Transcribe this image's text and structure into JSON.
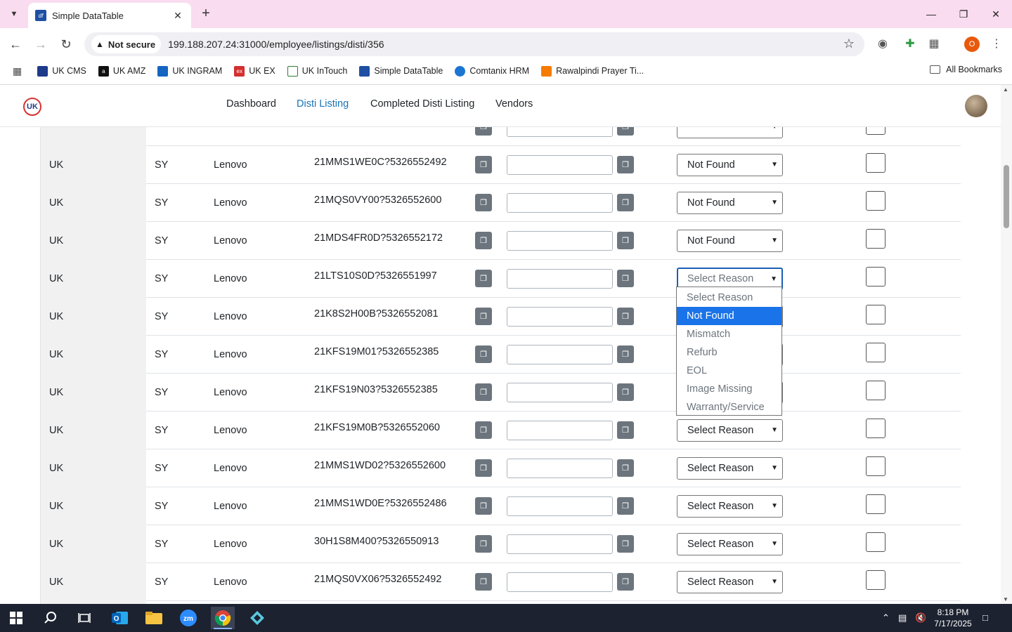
{
  "browser": {
    "tab_title": "Simple DataTable",
    "tab_favicon_text": "df",
    "security_label": "Not secure",
    "url": "199.188.207.24:31000/employee/listings/disti/356",
    "profile_initial": "O",
    "bookmarks": [
      {
        "label": "UK CMS",
        "color": "#1e3a8a"
      },
      {
        "label": "UK AMZ",
        "color": "#111111"
      },
      {
        "label": "UK INGRAM",
        "color": "#1565c0"
      },
      {
        "label": "UK EX",
        "color": "#d32f2f"
      },
      {
        "label": "UK InTouch",
        "color": "#2e7d32"
      },
      {
        "label": "Simple DataTable",
        "color": "#1e4fa3"
      },
      {
        "label": "Comtanix HRM",
        "color": "#1976d2"
      },
      {
        "label": "Rawalpindi Prayer Ti...",
        "color": "#f57c00"
      }
    ],
    "all_bookmarks": "All Bookmarks"
  },
  "app": {
    "logo_text": "UK",
    "nav": [
      "Dashboard",
      "Disti Listing",
      "Completed Disti Listing",
      "Vendors"
    ],
    "active_nav": "Disti Listing"
  },
  "table": {
    "rows": [
      {
        "country": "",
        "code": "",
        "brand": "",
        "sku": "",
        "reason": "",
        "partial": true
      },
      {
        "country": "UK",
        "code": "SY",
        "brand": "Lenovo",
        "sku": "21MMS1WE0C?5326552492",
        "reason": "Not Found"
      },
      {
        "country": "UK",
        "code": "SY",
        "brand": "Lenovo",
        "sku": "21MQS0VY00?5326552600",
        "reason": "Not Found"
      },
      {
        "country": "UK",
        "code": "SY",
        "brand": "Lenovo",
        "sku": "21MDS4FR0D?5326552172",
        "reason": "Not Found"
      },
      {
        "country": "UK",
        "code": "SY",
        "brand": "Lenovo",
        "sku": "21LTS10S0D?5326551997",
        "reason": "Select Reason",
        "focused": true
      },
      {
        "country": "UK",
        "code": "SY",
        "brand": "Lenovo",
        "sku": "21K8S2H00B?5326552081",
        "reason": "Select Reason"
      },
      {
        "country": "UK",
        "code": "SY",
        "brand": "Lenovo",
        "sku": "21KFS19M01?5326552385",
        "reason": "Select Reason"
      },
      {
        "country": "UK",
        "code": "SY",
        "brand": "Lenovo",
        "sku": "21KFS19N03?5326552385",
        "reason": "Select Reason"
      },
      {
        "country": "UK",
        "code": "SY",
        "brand": "Lenovo",
        "sku": "21KFS19M0B?5326552060",
        "reason": "Select Reason"
      },
      {
        "country": "UK",
        "code": "SY",
        "brand": "Lenovo",
        "sku": "21MMS1WD02?5326552600",
        "reason": "Select Reason"
      },
      {
        "country": "UK",
        "code": "SY",
        "brand": "Lenovo",
        "sku": "21MMS1WD0E?5326552486",
        "reason": "Select Reason"
      },
      {
        "country": "UK",
        "code": "SY",
        "brand": "Lenovo",
        "sku": "30H1S8M400?5326550913",
        "reason": "Select Reason"
      },
      {
        "country": "UK",
        "code": "SY",
        "brand": "Lenovo",
        "sku": "21MQS0VX06?5326552492",
        "reason": "Select Reason"
      },
      {
        "country": "",
        "code": "",
        "brand": "",
        "sku": "",
        "reason": "",
        "partial": true
      }
    ],
    "dropdown_options": [
      "Select Reason",
      "Not Found",
      "Mismatch",
      "Refurb",
      "EOL",
      "Image Missing",
      "Warranty/Service"
    ],
    "dropdown_highlighted": "Not Found"
  },
  "taskbar": {
    "time": "8:18 PM",
    "date": "7/17/2025",
    "zoom_label": "zm"
  },
  "colors": {
    "tabstrip": "#f9dcef",
    "active_link": "#1a73b8",
    "dropdown_highlight": "#1a73e8",
    "copy_button": "#6c757d",
    "taskbar": "#1c2230"
  }
}
